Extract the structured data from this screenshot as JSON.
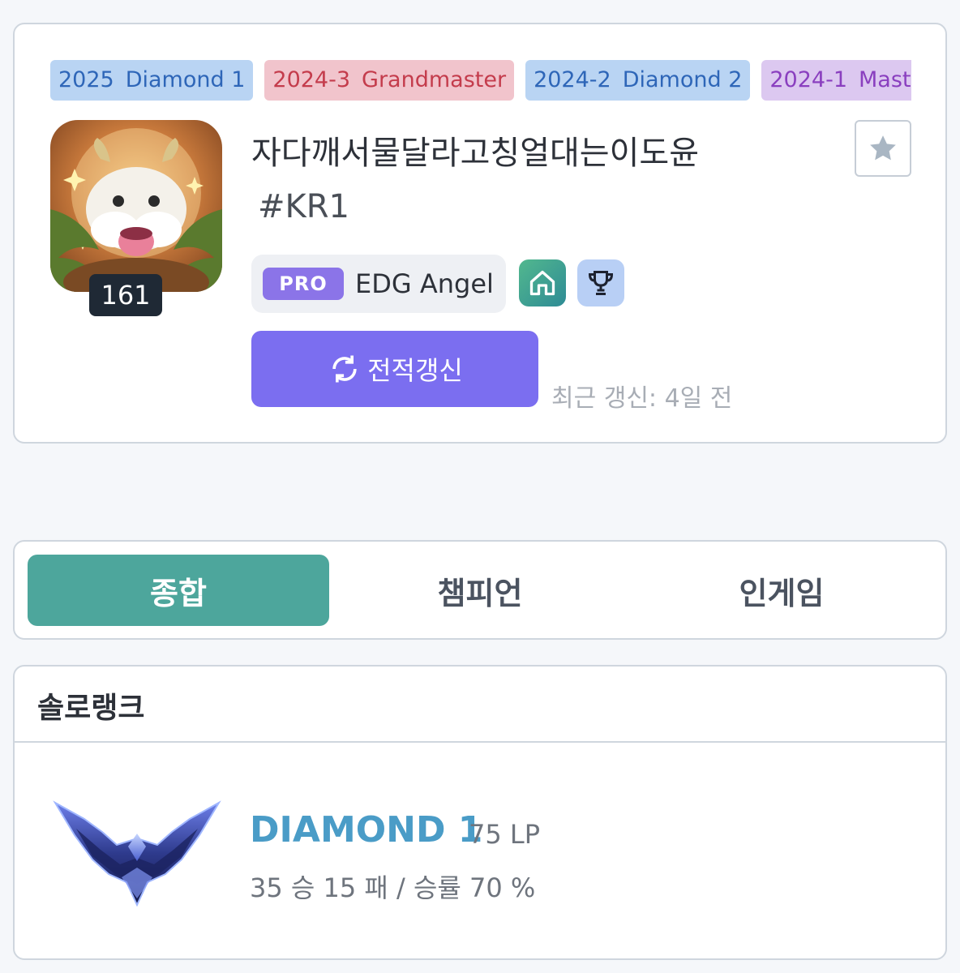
{
  "seasons": [
    {
      "year": "2025",
      "tier": "Diamond 1",
      "color": "blue"
    },
    {
      "year": "2024-3",
      "tier": "Grandmaster",
      "color": "red"
    },
    {
      "year": "2024-2",
      "tier": "Diamond 2",
      "color": "blue"
    },
    {
      "year": "2024-1",
      "tier": "Master",
      "color": "purple"
    }
  ],
  "profile": {
    "level": "161",
    "name": "자다깨서물달라고칭얼대는이도윤",
    "tag": "#KR1",
    "pro_badge": "PRO",
    "pro_name": "EDG Angel",
    "refresh_label": "전적갱신",
    "last_updated": "최근 갱신: 4일 전"
  },
  "tabs": [
    "종합",
    "챔피언",
    "인게임"
  ],
  "solo_rank": {
    "title": "솔로랭크",
    "tier": "DIAMOND 1",
    "lp": "75 LP",
    "record": "35 승 15 패 / 승률 70 %"
  },
  "colors": {
    "accent_purple": "#7b6ef0",
    "tab_active": "#4da69c",
    "tier_blue": "#4a9cc7"
  }
}
